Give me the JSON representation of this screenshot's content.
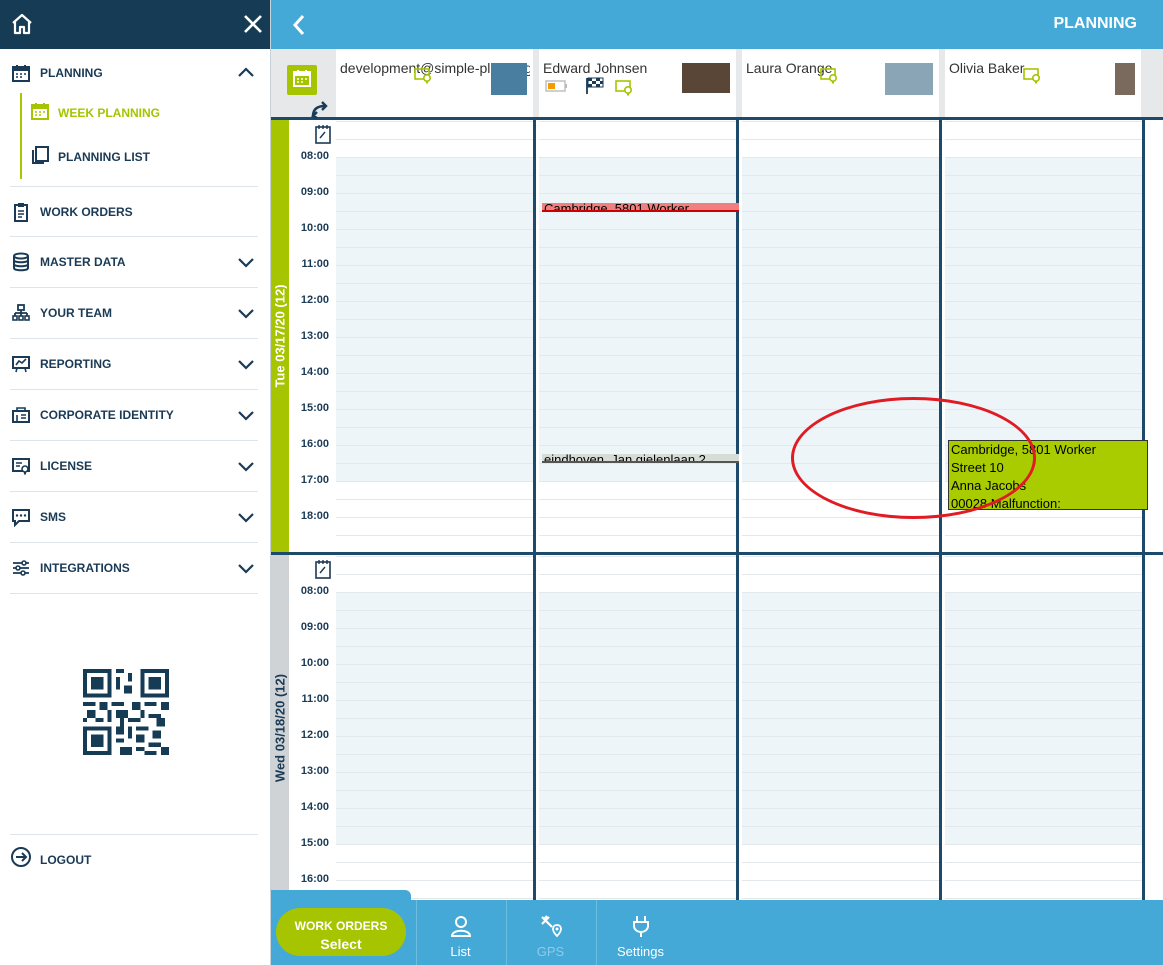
{
  "header": {
    "title": "PLANNING"
  },
  "sidebar": {
    "items": [
      {
        "label": "PLANNING",
        "icon": "calendar-icon"
      },
      {
        "label": "WORK ORDERS",
        "icon": "clipboard-icon"
      },
      {
        "label": "MASTER DATA",
        "icon": "database-icon"
      },
      {
        "label": "YOUR TEAM",
        "icon": "team-icon"
      },
      {
        "label": "REPORTING",
        "icon": "presentation-icon"
      },
      {
        "label": "CORPORATE IDENTITY",
        "icon": "identity-icon"
      },
      {
        "label": "LICENSE",
        "icon": "license-icon"
      },
      {
        "label": "SMS",
        "icon": "chat-icon"
      },
      {
        "label": "INTEGRATIONS",
        "icon": "sliders-icon"
      }
    ],
    "sub_items": [
      {
        "label": "WEEK PLANNING",
        "icon": "calendar-icon"
      },
      {
        "label": "PLANNING LIST",
        "icon": "copy-icon"
      }
    ],
    "logout": "LOGOUT"
  },
  "employees": [
    {
      "name": "development@simple-planning"
    },
    {
      "name": "Edward Johnsen"
    },
    {
      "name": "Laura Orange"
    },
    {
      "name": "Olivia Baker"
    }
  ],
  "days": [
    {
      "label": "Tue 03/17/20 (12)"
    },
    {
      "label": "Wed 03/18/20 (12)"
    }
  ],
  "times": [
    "08:00",
    "09:00",
    "10:00",
    "11:00",
    "12:00",
    "13:00",
    "14:00",
    "15:00",
    "16:00",
    "17:00",
    "18:00"
  ],
  "events": {
    "tue_edward_1": "Cambridge, 5801 Worker",
    "tue_edward_2": "eindhoven, Jan gielenlaan 2",
    "tue_olivia": [
      "Cambridge, 5801 Worker",
      "Street 10",
      "Anna Jacobs",
      "00028 Malfunction:"
    ]
  },
  "bottom": {
    "work_orders_1": "WORK ORDERS",
    "work_orders_2": "Select",
    "list": "List",
    "gps": "GPS",
    "settings": "Settings"
  },
  "colors": {
    "accent": "#a6c400",
    "navy": "#163b55",
    "topbar": "#44a9d6",
    "highlight": "#e01b24"
  }
}
